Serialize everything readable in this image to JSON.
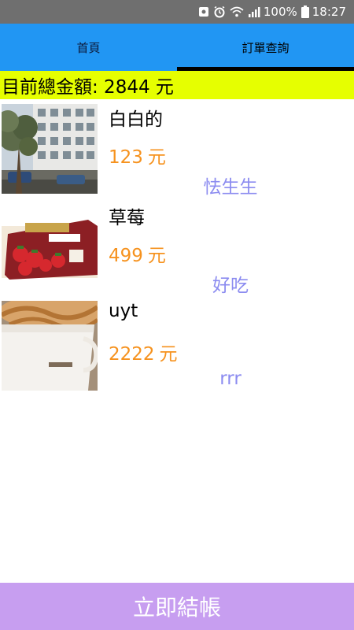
{
  "status_bar": {
    "battery_percent": "100%",
    "time": "18:27",
    "icons": [
      "notification-icon",
      "alarm-icon",
      "wifi-icon",
      "signal-icon",
      "battery-icon"
    ]
  },
  "tabs": [
    {
      "label": "首頁",
      "active": false
    },
    {
      "label": "訂單查詢",
      "active": true
    }
  ],
  "total": {
    "label": "目前總金額: 2844 元"
  },
  "orders": [
    {
      "name": "白白的",
      "price": "123",
      "unit": "元",
      "note": "怯生生",
      "image": "street-building-photo"
    },
    {
      "name": "草莓",
      "price": "499",
      "unit": "元",
      "note": "好吃",
      "image": "strawberry-box-photo"
    },
    {
      "name": "uyt",
      "price": "2222",
      "unit": "元",
      "note": "rrr",
      "image": "latte-cup-photo"
    }
  ],
  "checkout": {
    "label": "立即結帳"
  },
  "colors": {
    "status_bar": "#6f6f6f",
    "tab_bar": "#2196f3",
    "tab_indicator": "#000000",
    "total_banner": "#e6ff00",
    "price": "#f6921e",
    "note": "#8c8cf0",
    "checkout": "#c79ef0"
  }
}
